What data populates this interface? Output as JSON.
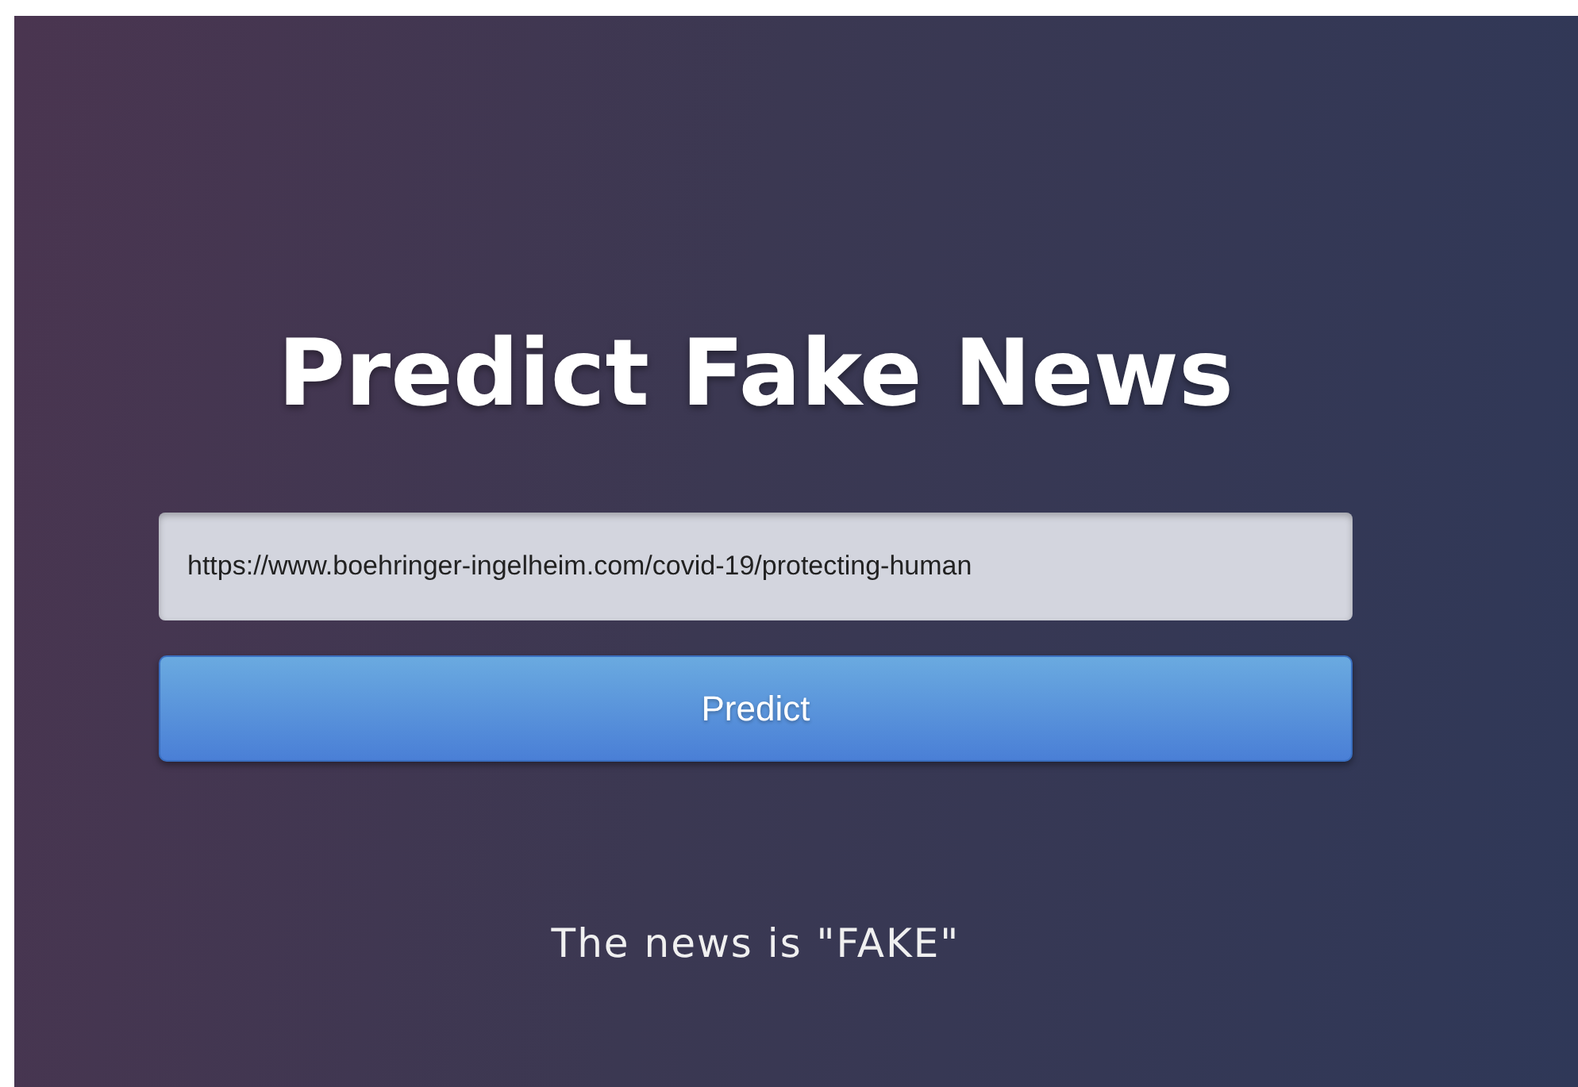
{
  "title": "Predict Fake News",
  "url_field": {
    "value": "https://www.boehringer-ingelheim.com/covid-19/protecting-human"
  },
  "predict_button": {
    "label": "Predict"
  },
  "result": "The news is \"FAKE\""
}
